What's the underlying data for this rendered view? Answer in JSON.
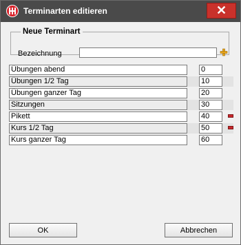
{
  "window": {
    "title": "Terminarten editieren",
    "close_glyph": "✕"
  },
  "group": {
    "legend": "Neue Terminart",
    "bezeichnung_label": "Bezeichnung",
    "bezeichnung_value": "",
    "add_icon": "plus-icon"
  },
  "rows": [
    {
      "name": "Übungen abend",
      "number": "0",
      "removable": false
    },
    {
      "name": "Übungen 1/2 Tag",
      "number": "10",
      "removable": false
    },
    {
      "name": "Übungen ganzer Tag",
      "number": "20",
      "removable": false
    },
    {
      "name": "Sitzungen",
      "number": "30",
      "removable": false
    },
    {
      "name": "Pikett",
      "number": "40",
      "removable": true
    },
    {
      "name": "Kurs 1/2 Tag",
      "number": "50",
      "removable": true
    },
    {
      "name": "Kurs ganzer Tag",
      "number": "60",
      "removable": false
    }
  ],
  "buttons": {
    "ok": "OK",
    "cancel": "Abbrechen"
  },
  "colors": {
    "titlebar": "#4a4a4a",
    "close": "#c9312b",
    "remove": "#c8282d",
    "add": "#e8a51a"
  }
}
